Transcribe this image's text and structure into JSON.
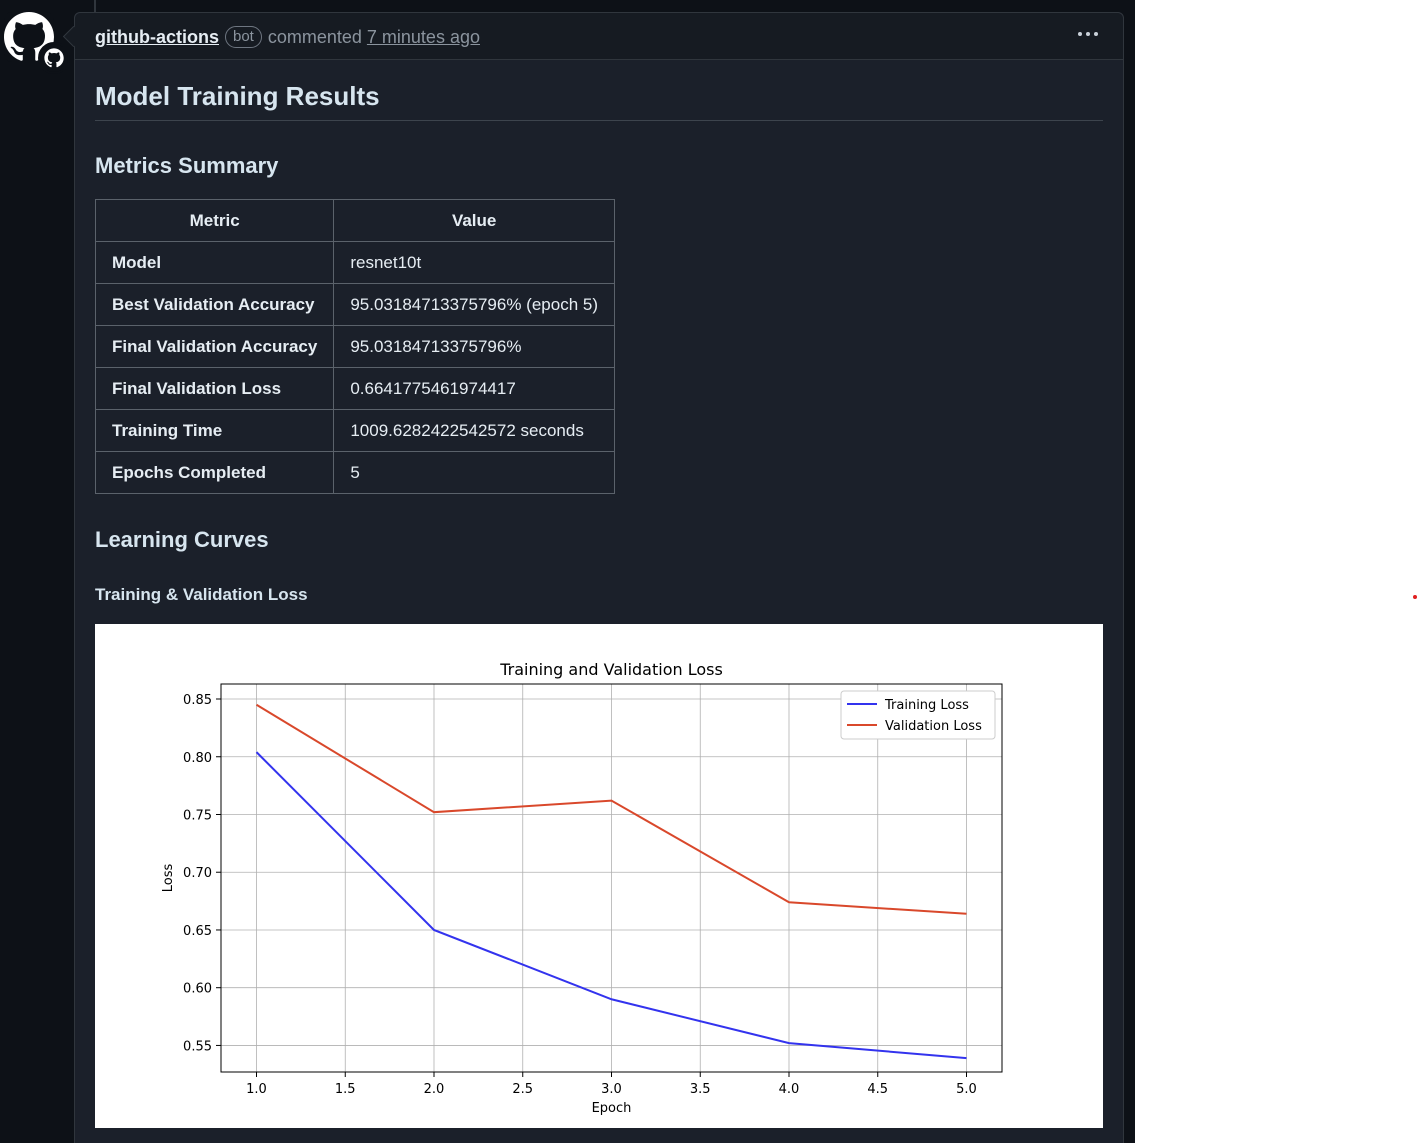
{
  "comment": {
    "author": "github-actions",
    "badge": "bot",
    "action": "commented",
    "time": "7 minutes ago"
  },
  "body": {
    "title": "Model Training Results",
    "metrics_heading": "Metrics Summary",
    "table": {
      "headers": [
        "Metric",
        "Value"
      ],
      "rows": [
        [
          "Model",
          "resnet10t"
        ],
        [
          "Best Validation Accuracy",
          "95.03184713375796% (epoch 5)"
        ],
        [
          "Final Validation Accuracy",
          "95.03184713375796%"
        ],
        [
          "Final Validation Loss",
          "0.6641775461974417"
        ],
        [
          "Training Time",
          "1009.6282422542572 seconds"
        ],
        [
          "Epochs Completed",
          "5"
        ]
      ]
    },
    "curves_heading": "Learning Curves",
    "loss_subheading": "Training & Validation Loss"
  },
  "colors": {
    "training": "#3333ee",
    "validation": "#d9482b"
  },
  "chart_data": {
    "type": "line",
    "title": "Training and Validation Loss",
    "xlabel": "Epoch",
    "ylabel": "Loss",
    "x": [
      1,
      2,
      3,
      4,
      5
    ],
    "series": [
      {
        "name": "Training Loss",
        "values": [
          0.804,
          0.65,
          0.59,
          0.552,
          0.539
        ]
      },
      {
        "name": "Validation Loss",
        "values": [
          0.845,
          0.752,
          0.762,
          0.674,
          0.664
        ]
      }
    ],
    "xlim": [
      0.8,
      5.2
    ],
    "ylim": [
      0.527,
      0.863
    ],
    "xticks": [
      "1.0",
      "1.5",
      "2.0",
      "2.5",
      "3.0",
      "3.5",
      "4.0",
      "4.5",
      "5.0"
    ],
    "yticks": [
      "0.55",
      "0.60",
      "0.65",
      "0.70",
      "0.75",
      "0.80",
      "0.85"
    ],
    "grid": true,
    "legend": "top-right"
  }
}
